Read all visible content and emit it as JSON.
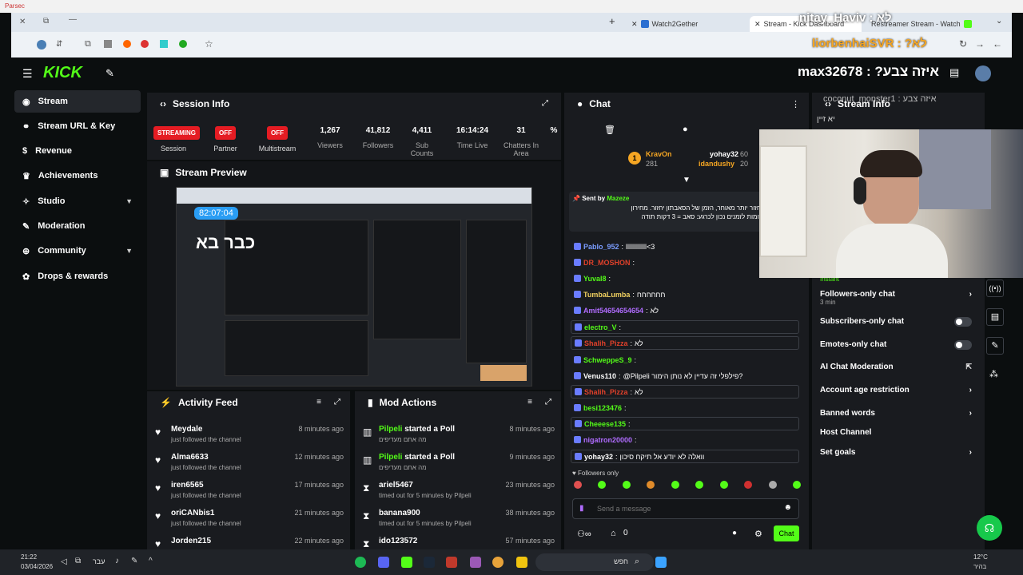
{
  "os": {
    "app_title": "Parsec"
  },
  "browser": {
    "tabs": [
      {
        "label": "Watch2Gether"
      },
      {
        "label": "Stream - Kick Dashboard"
      },
      {
        "label": "Restreamer Stream - Watch"
      }
    ],
    "overlay_top": "nitay_Haviv : לא",
    "overlay_second": "liorbenhaiSVR : ?לא"
  },
  "topnav": {
    "logo": "KICK",
    "title": "max32678 : ?איזה צבע"
  },
  "sidebar": {
    "items": [
      {
        "label": "Stream",
        "icon": "radio-icon"
      },
      {
        "label": "Stream URL & Key",
        "icon": "link-icon"
      },
      {
        "label": "Revenue",
        "icon": "dollar-icon"
      },
      {
        "label": "Achievements",
        "icon": "trophy-icon"
      },
      {
        "label": "Studio",
        "icon": "studio-icon"
      },
      {
        "label": "Moderation",
        "icon": "wrench-icon"
      },
      {
        "label": "Community",
        "icon": "globe-icon"
      },
      {
        "label": "Drops & rewards",
        "icon": "gift-icon"
      }
    ]
  },
  "session_info": {
    "title": "Session Info",
    "stats": [
      {
        "value": "STREAMING",
        "label": "Session",
        "badge": true
      },
      {
        "value": "OFF",
        "label": "Partner",
        "badge": true
      },
      {
        "value": "OFF",
        "label": "Multistream",
        "badge": true
      },
      {
        "value": "1,267",
        "label": "Viewers"
      },
      {
        "value": "41,812",
        "label": "Followers"
      },
      {
        "value": "4,411",
        "label": "Sub Counts"
      },
      {
        "value": "16:14:24",
        "label": "Time Live"
      },
      {
        "value": "31",
        "label": "Chatters In Area"
      },
      {
        "value": "%",
        "label": ""
      }
    ]
  },
  "stream_preview": {
    "title": "Stream Preview",
    "timer": "82:07:04",
    "overlay_text": "כבר בא"
  },
  "activity_feed": {
    "title": "Activity Feed",
    "items": [
      {
        "name": "Meydale",
        "sub": "just followed the channel",
        "time": "8 minutes ago"
      },
      {
        "name": "Alma6633",
        "sub": "just followed the channel",
        "time": "12 minutes ago"
      },
      {
        "name": "iren6565",
        "sub": "just followed the channel",
        "time": "17 minutes ago"
      },
      {
        "name": "oriCANbis1",
        "sub": "just followed the channel",
        "time": "21 minutes ago"
      },
      {
        "name": "Jorden215",
        "sub": "",
        "time": "22 minutes ago"
      }
    ]
  },
  "mod_actions": {
    "title": "Mod Actions",
    "items": [
      {
        "name": "Pilpeli",
        "action": "started a Poll",
        "sub": "מה אתם מעדיפים",
        "time": "8 minutes ago"
      },
      {
        "name": "Pilpeli",
        "action": "started a Poll",
        "sub": "מה אתם מעדיפים",
        "time": "9 minutes ago"
      },
      {
        "name": "ariel5467",
        "action": "",
        "sub": "timed out for 5 minutes by Pilpeli",
        "time": "23 minutes ago"
      },
      {
        "name": "banana900",
        "action": "",
        "sub": "timed out for 5 minutes by Pilpeli",
        "time": "38 minutes ago"
      },
      {
        "name": "ido123572",
        "action": "",
        "sub": "",
        "time": "57 minutes ago"
      }
    ]
  },
  "chat": {
    "title": "Chat",
    "top_gifters": [
      {
        "name": "KravOn",
        "count": "281"
      },
      {
        "name": "yohay32",
        "count": "60"
      },
      {
        "name": "idandushy",
        "count": "20"
      }
    ],
    "pinned_by": "Sent by",
    "pinned_user": "Mazeze",
    "pinned_text": "...יד הלך לנוח יחזור יותר מאוחר, הזמן של הסאבתון יחזור. מחירון",
    "pinned_text2": "...הזמנות - התרומות לזמנים נכון לכרגע: סאב = 3 דקות תודה",
    "messages": [
      {
        "user": "Pablo_952",
        "text": "lllllllllllll<3",
        "color": "#7a9cff",
        "hl": false
      },
      {
        "user": "DR_MOSHON",
        "text": "",
        "color": "#e0402a",
        "hl": false
      },
      {
        "user": "Yuval8",
        "text": "",
        "color": "#53fc18",
        "hl": false
      },
      {
        "user": "TumbaLumba",
        "text": "חחחחחח",
        "color": "#f0d060",
        "hl": false
      },
      {
        "user": "Amit54654654654",
        "text": "לא",
        "color": "#b06cff",
        "hl": false
      },
      {
        "user": "electro_V",
        "text": "",
        "color": "#53fc18",
        "hl": true
      },
      {
        "user": "Shalih_Pizza",
        "text": "לא",
        "color": "#e0402a",
        "hl": true
      },
      {
        "user": "SchweppeS_9",
        "text": "",
        "color": "#53fc18",
        "hl": false
      },
      {
        "user": "Venus110",
        "text": "@Pilpeli פילפלי זה עדיין לא נותן הימור?",
        "color": "#ffffff",
        "hl": false
      },
      {
        "user": "Shalih_Pizza",
        "text": "לא",
        "color": "#e0402a",
        "hl": true
      },
      {
        "user": "besi123476",
        "text": "",
        "color": "#53fc18",
        "hl": false
      },
      {
        "user": "Cheeese135",
        "text": "",
        "color": "#53fc18",
        "hl": true
      },
      {
        "user": "nigatron20000",
        "text": "",
        "color": "#b06cff",
        "hl": false
      },
      {
        "user": "yohay32",
        "text": "וואלה לא יודע אל תיקח סיכון",
        "color": "#ffffff",
        "hl": true
      }
    ],
    "followers_only": "Followers only",
    "input_placeholder": "Send a message",
    "bottom_count": "0",
    "send_label": "Chat"
  },
  "stream_info": {
    "title": "Stream Info",
    "overlay_user": "coconut_monster1 : איזה צבע",
    "overlay_reply": "יא זיין",
    "settings": [
      {
        "label": "Instant",
        "type": "sub"
      },
      {
        "label": "Followers-only chat",
        "sub": "3 min",
        "type": "arrow"
      },
      {
        "label": "Subscribers-only chat",
        "type": "toggle"
      },
      {
        "label": "Emotes-only chat",
        "type": "toggle"
      },
      {
        "label": "AI Chat Moderation",
        "type": "external"
      },
      {
        "label": "Account age restriction",
        "type": "arrow"
      },
      {
        "label": "Banned words",
        "type": "arrow"
      },
      {
        "label": "Host Channel",
        "type": "none"
      },
      {
        "label": "Set goals",
        "type": "arrow"
      }
    ]
  },
  "taskbar": {
    "time": "21:22",
    "date": "03/04/2026",
    "lang": "עבר",
    "search": "חפש",
    "weather": "12°C",
    "weather_sub": "בהיר"
  },
  "colors": {
    "kick_green": "#53fc18",
    "live_red": "#e51c23",
    "panel": "#191b1f"
  }
}
